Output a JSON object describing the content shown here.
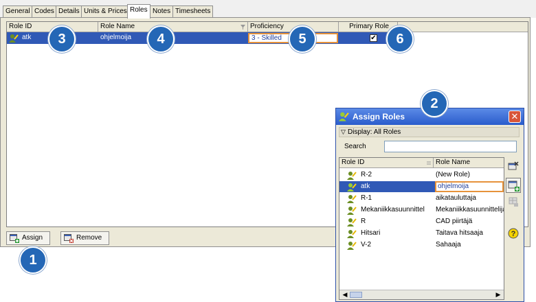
{
  "tabs": [
    "General",
    "Codes",
    "Details",
    "Units & Prices",
    "Roles",
    "Notes",
    "Timesheets"
  ],
  "active_tab": "Roles",
  "grid": {
    "columns": [
      "Role ID",
      "Role Name",
      "Proficiency",
      "Primary Role"
    ],
    "rows": [
      {
        "role_id": "atk",
        "role_name": "ohjelmoija",
        "proficiency": "3 - Skilled",
        "primary_role_mark": "✔"
      }
    ]
  },
  "buttons": {
    "assign": "Assign",
    "remove": "Remove"
  },
  "dialog": {
    "title": "Assign Roles",
    "close_glyph": "✕",
    "display_label": "Display: All Roles",
    "display_chevron": "▽",
    "search_label": "Search",
    "search_value": "",
    "columns": [
      "Role ID",
      "Role Name"
    ],
    "rows": [
      {
        "role_id": "R-2",
        "role_name": "(New Role)"
      },
      {
        "role_id": "atk",
        "role_name": "ohjelmoija",
        "selected": true
      },
      {
        "role_id": "R-1",
        "role_name": "aikatauluttaja"
      },
      {
        "role_id": "Mekaniikkasuunnittel",
        "role_name": "Mekaniikkasuunnittelija"
      },
      {
        "role_id": "R",
        "role_name": "CAD piirtäjä"
      },
      {
        "role_id": "Hitsari",
        "role_name": "Taitava hitsaaja"
      },
      {
        "role_id": "V-2",
        "role_name": "Sahaaja"
      }
    ],
    "scroll_left": "◀",
    "scroll_right": "▶"
  },
  "callouts": [
    "1",
    "2",
    "3",
    "4",
    "5",
    "6"
  ],
  "colors": {
    "selection": "#3059b6",
    "callout": "#2467b6",
    "outline": "#e6923a",
    "title_bar": "#2a5ccc"
  }
}
